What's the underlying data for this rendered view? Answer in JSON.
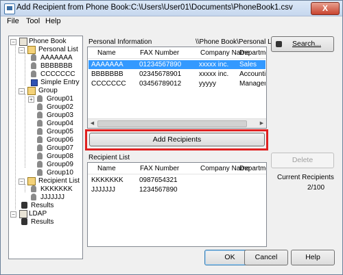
{
  "window": {
    "title": "Add Recipient from Phone Book:C:\\Users\\User01\\Documents\\PhoneBook1.csv",
    "close_label": "X"
  },
  "menu": {
    "file": "File",
    "tool": "Tool",
    "help": "Help"
  },
  "tree": {
    "phone_book": "Phone Book",
    "personal_list": "Personal List",
    "entries": [
      "AAAAAAA",
      "BBBBBBB",
      "CCCCCCC"
    ],
    "simple_entry": "Simple Entry",
    "group": "Group",
    "groups": [
      "Group01",
      "Group02",
      "Group03",
      "Group04",
      "Group05",
      "Group06",
      "Group07",
      "Group08",
      "Group09",
      "Group10"
    ],
    "recipient_list": "Recipient List",
    "recipients": [
      "KKKKKKK",
      "JJJJJJJ"
    ],
    "results": "Results",
    "ldap": "LDAP",
    "ldap_results": "Results"
  },
  "personal_info": {
    "label": "Personal Information",
    "path": "\\\\Phone Book\\Personal List",
    "columns": [
      "Name",
      "FAX Number",
      "Company Name",
      "Departmer"
    ],
    "rows": [
      [
        "AAAAAAA",
        "01234567890",
        "xxxxx inc.",
        "Sales"
      ],
      [
        "BBBBBBB",
        "02345678901",
        "xxxxx inc.",
        "Accounting"
      ],
      [
        "CCCCCCC",
        "03456789012",
        "yyyyy",
        "Manageme"
      ]
    ],
    "selected_row": 0
  },
  "buttons": {
    "search": "Search...",
    "add_recipients": "Add Recipients",
    "delete": "Delete",
    "ok": "OK",
    "cancel": "Cancel",
    "help": "Help"
  },
  "recipient_list": {
    "label": "Recipient List",
    "columns": [
      "Name",
      "FAX Number",
      "Company Name",
      "Departmer"
    ],
    "rows": [
      [
        "KKKKKKK",
        "0987654321",
        "",
        ""
      ],
      [
        "JJJJJJJ",
        "1234567890",
        "",
        ""
      ]
    ]
  },
  "current_recipients": {
    "label": "Current Recipients",
    "value": "2/100"
  },
  "colors": {
    "selection": "#3399ff",
    "highlight_border": "#e02020"
  }
}
